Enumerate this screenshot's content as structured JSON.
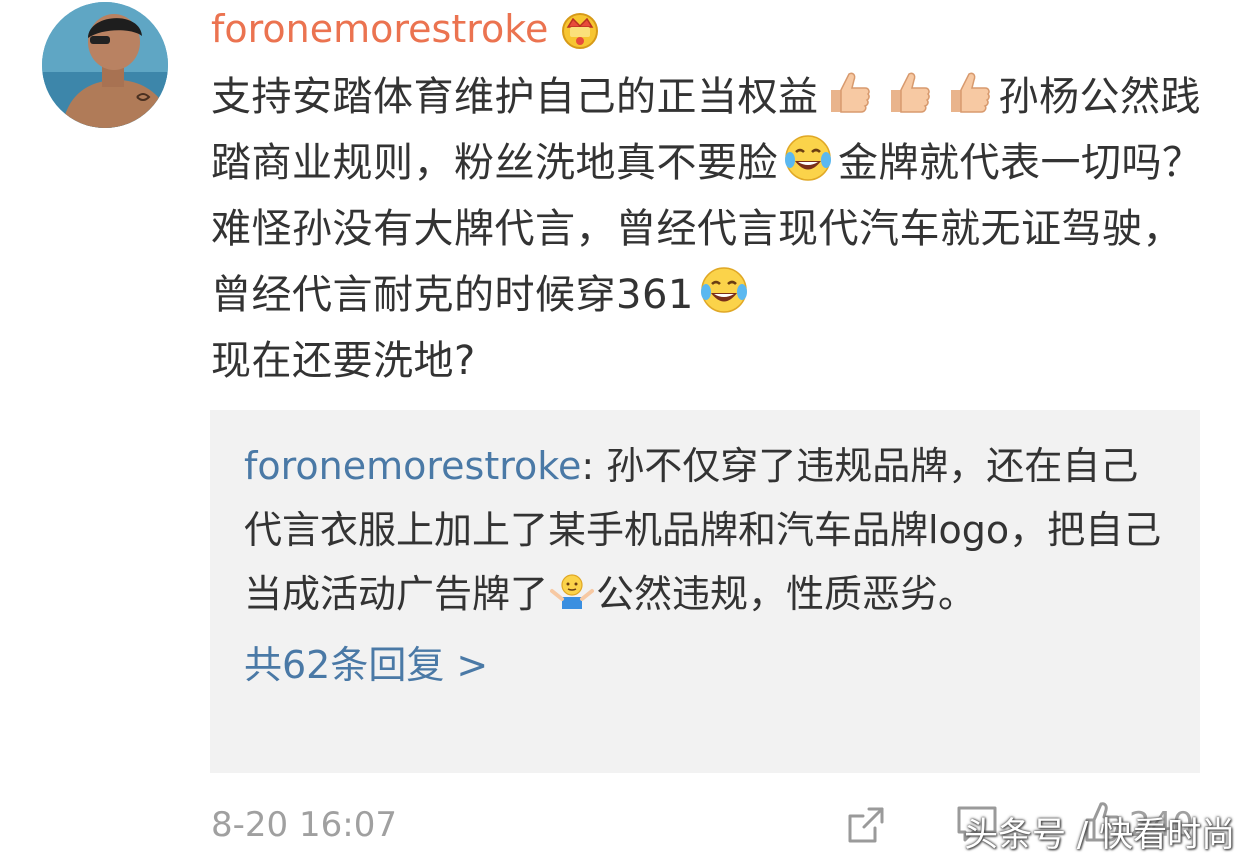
{
  "comment": {
    "username": "foronemorestroke",
    "badge_icon": "crown-badge-icon",
    "text_parts": {
      "p1": "支持安踏体育维护自己的正当权益",
      "p2": "孙杨公然践踏商业规则，粉丝洗地真不要脸",
      "p3": "金牌就代表一切吗？难怪孙没有大牌代言，曾经代言现代汽车就无证驾驶，曾经代言耐克的时候穿361",
      "p4": "现在还要洗地?"
    },
    "emojis": [
      "thumbs-up-icon",
      "thumbs-up-icon",
      "thumbs-up-icon",
      "laugh-tears-icon",
      "laugh-tears-icon"
    ]
  },
  "reply": {
    "username": "foronemorestroke",
    "separator": ": ",
    "text_before_emoji": "孙不仅穿了违规品牌，还在自己代言衣服上加上了某手机品牌和汽车品牌logo，把自己当成活动广告牌了",
    "emoji": "shrug-icon",
    "text_after_emoji": "公然违规，性质恶劣。",
    "more_replies_label": "共62条回复 >"
  },
  "footer": {
    "timestamp": "8-20 16:07",
    "like_count": "240"
  },
  "watermark": "头条号 / 快看时尚",
  "colors": {
    "username": "#eb7350",
    "link": "#4a79a6",
    "body_text": "#333333",
    "meta_text": "#a0a0a0",
    "reply_bg": "#f2f2f2"
  }
}
